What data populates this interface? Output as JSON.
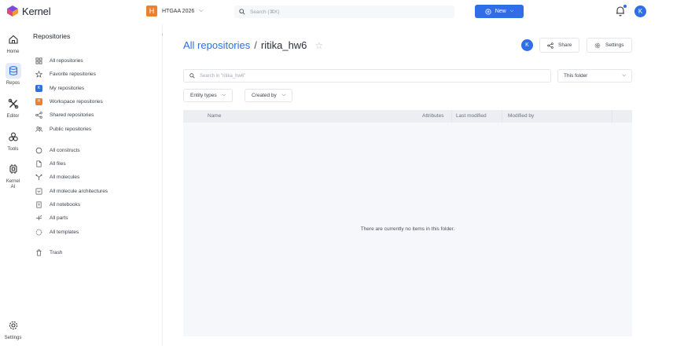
{
  "app": {
    "name": "Kernel"
  },
  "topbar": {
    "workspace_badge": "H",
    "workspace_name": "HTGAA 2026",
    "search_placeholder": "Search (⌘K)",
    "new_label": "New",
    "user_initial": "K",
    "accent": "#2f6ee8",
    "workspace_color": "#f07f2c"
  },
  "rail": {
    "items": [
      {
        "label": "Home",
        "icon": "home-icon"
      },
      {
        "label": "Repos",
        "icon": "database-icon"
      },
      {
        "label": "Editor",
        "icon": "tools-cross-icon"
      },
      {
        "label": "Tools",
        "icon": "circles-icon"
      },
      {
        "label": "Kernel AI",
        "icon": "chip-icon"
      },
      {
        "label": "Settings",
        "icon": "gear-icon"
      }
    ]
  },
  "sidebar": {
    "title": "Repositories",
    "collapse": "«",
    "groups": [
      [
        {
          "label": "All repositories",
          "icon": "grid-icon"
        },
        {
          "label": "Favorite repositories",
          "icon": "star-icon"
        },
        {
          "label": "My repositories",
          "icon": "user-badge-icon",
          "badge": "K"
        },
        {
          "label": "Workspace repositories",
          "icon": "workspace-badge-icon",
          "badge": "H"
        },
        {
          "label": "Shared repositories",
          "icon": "share-icon"
        },
        {
          "label": "Public repositories",
          "icon": "people-icon"
        }
      ],
      [
        {
          "label": "All constructs",
          "icon": "circle-icon"
        },
        {
          "label": "All files",
          "icon": "file-icon"
        },
        {
          "label": "All molecules",
          "icon": "molecule-icon"
        },
        {
          "label": "All molecule architectures",
          "icon": "architecture-icon"
        },
        {
          "label": "All notebooks",
          "icon": "notebook-icon"
        },
        {
          "label": "All parts",
          "icon": "parts-icon"
        },
        {
          "label": "All templates",
          "icon": "template-icon"
        }
      ],
      [
        {
          "label": "Trash",
          "icon": "trash-icon"
        }
      ]
    ]
  },
  "main": {
    "breadcrumb_root": "All repositories",
    "breadcrumb_sep": "/",
    "breadcrumb_current": "ritika_hw6",
    "avatar": "K",
    "share_label": "Share",
    "settings_label": "Settings",
    "search_placeholder": "Search in \"ritika_hw6\"",
    "scope_value": "This folder",
    "filters": [
      "Entity types",
      "Created by"
    ],
    "columns": [
      "Name",
      "Attributes",
      "Last modified",
      "Modified by"
    ],
    "empty_message": "There are currently no items in this folder."
  }
}
